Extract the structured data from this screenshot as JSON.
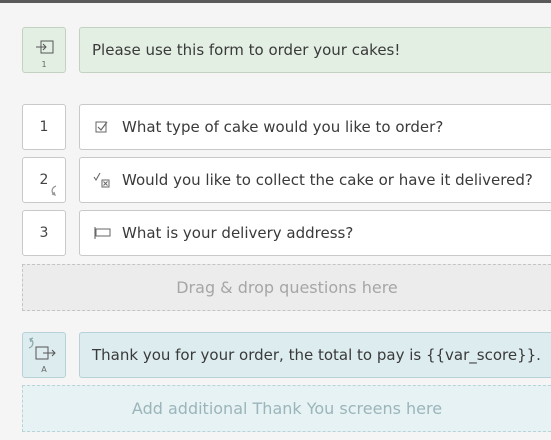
{
  "welcome": {
    "text": "Please use this form to order your cakes!",
    "badge": "1"
  },
  "questions": [
    {
      "number": "1",
      "text": "What type of cake would you like to order?",
      "icon": "checkbox-icon"
    },
    {
      "number": "2",
      "text": "Would you like to collect the cake or have it delivered?",
      "icon": "multiple-choice-icon"
    },
    {
      "number": "3",
      "text": "What is your delivery address?",
      "icon": "text-field-icon"
    }
  ],
  "dropzone_questions": "Drag & drop questions here",
  "thankyou": {
    "text": "Thank you for your order, the total to pay is {{var_score}}.",
    "badge": "A"
  },
  "dropzone_thankyou": "Add additional Thank You screens here",
  "colors": {
    "welcome_bg": "#e4efe4",
    "thankyou_bg": "#dcecef",
    "dropzone_grey": "#ececec",
    "dropzone_blue": "#e6f2f4"
  }
}
